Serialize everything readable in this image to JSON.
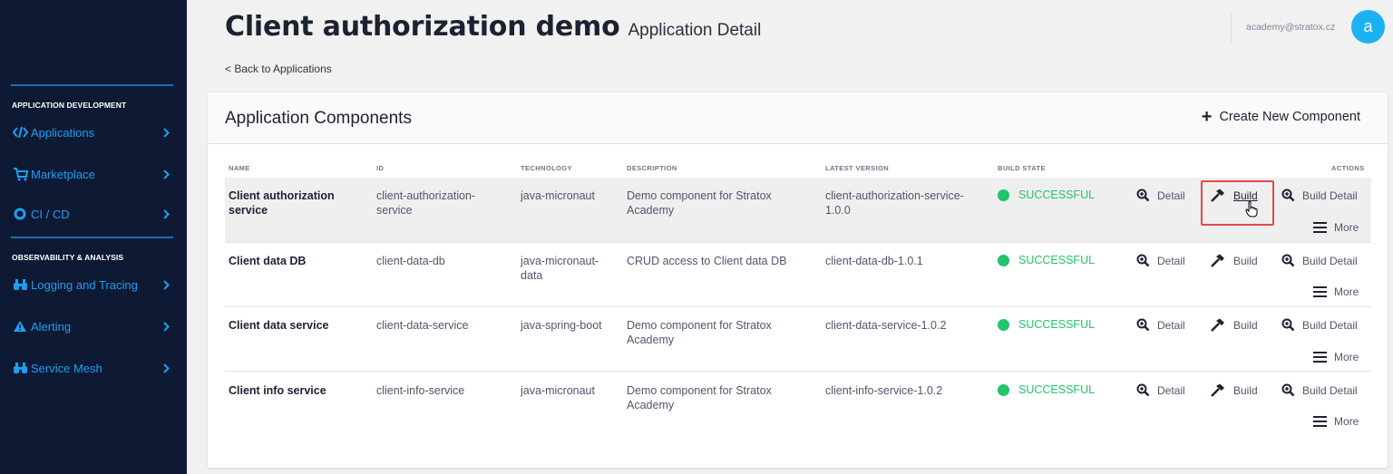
{
  "header": {
    "title": "Client authorization demo",
    "subtitle": "Application Detail",
    "back_link": "< Back to Applications",
    "user_email": "academy@stratox.cz",
    "avatar_letter": "a"
  },
  "sidebar": {
    "sections": [
      {
        "title": "APPLICATION DEVELOPMENT"
      },
      {
        "title": "OBSERVABILITY & ANALYSIS"
      }
    ],
    "items": [
      {
        "label": "Applications",
        "icon": "code-icon"
      },
      {
        "label": "Marketplace",
        "icon": "cart-icon"
      },
      {
        "label": "CI / CD",
        "icon": "circle-icon"
      },
      {
        "label": "Logging and Tracing",
        "icon": "binoculars-icon"
      },
      {
        "label": "Alerting",
        "icon": "warning-icon"
      },
      {
        "label": "Service Mesh",
        "icon": "binoculars-icon"
      }
    ]
  },
  "card": {
    "title": "Application Components",
    "create_label": "Create New Component"
  },
  "table": {
    "columns": [
      "NAME",
      "ID",
      "TECHNOLOGY",
      "DESCRIPTION",
      "LATEST VERSION",
      "BUILD STATE",
      "ACTIONS"
    ],
    "actions": {
      "detail": "Detail",
      "build": "Build",
      "build_detail": "Build Detail",
      "more": "More"
    },
    "rows": [
      {
        "name_1": "Client authorization",
        "name_2": "service",
        "id_1": "client-authorization-",
        "id_2": "service",
        "tech_1": "java-micronaut",
        "tech_2": "",
        "desc_1": "Demo component for Stratox",
        "desc_2": "Academy",
        "ver_1": "client-authorization-service-",
        "ver_2": "1.0.0",
        "state": "SUCCESSFUL"
      },
      {
        "name_1": "Client data DB",
        "name_2": "",
        "id_1": "client-data-db",
        "id_2": "",
        "tech_1": "java-micronaut-",
        "tech_2": "data",
        "desc_1": "CRUD access to Client data DB",
        "desc_2": "",
        "ver_1": "client-data-db-1.0.1",
        "ver_2": "",
        "state": "SUCCESSFUL"
      },
      {
        "name_1": "Client data service",
        "name_2": "",
        "id_1": "client-data-service",
        "id_2": "",
        "tech_1": "java-spring-boot",
        "tech_2": "",
        "desc_1": "Demo component for Stratox",
        "desc_2": "Academy",
        "ver_1": "client-data-service-1.0.2",
        "ver_2": "",
        "state": "SUCCESSFUL"
      },
      {
        "name_1": "Client info service",
        "name_2": "",
        "id_1": "client-info-service",
        "id_2": "",
        "tech_1": "java-micronaut",
        "tech_2": "",
        "desc_1": "Demo component for Stratox",
        "desc_2": "Academy",
        "ver_1": "client-info-service-1.0.2",
        "ver_2": "",
        "state": "SUCCESSFUL"
      }
    ]
  },
  "colors": {
    "sidebar_bg": "#0e1a33",
    "accent": "#1d9ff0",
    "success": "#22c46c",
    "highlight_border": "#e34b4b"
  }
}
